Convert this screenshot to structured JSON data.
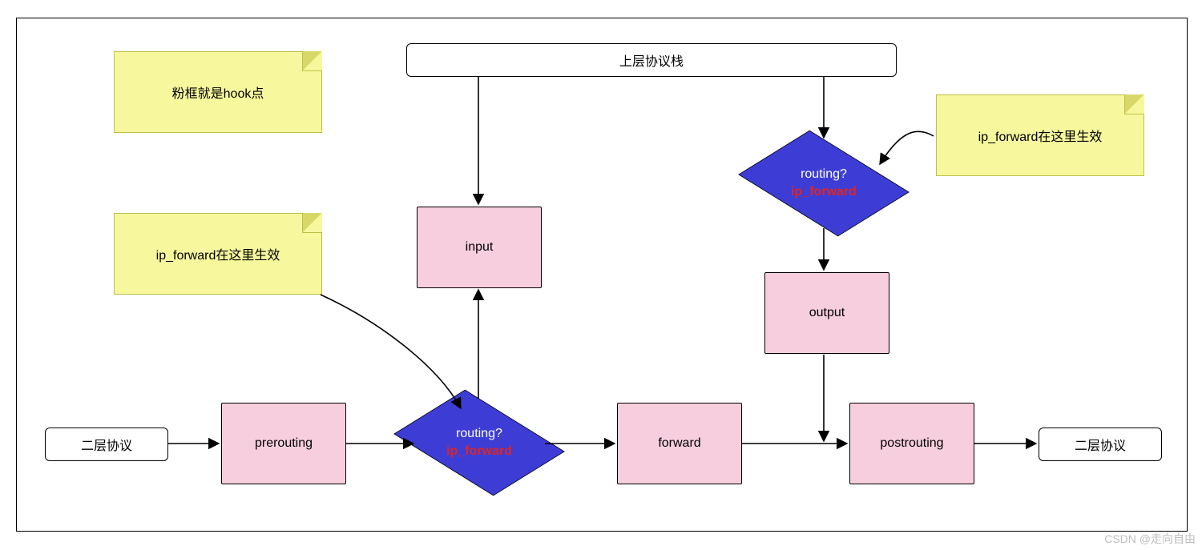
{
  "notes": {
    "legend": "粉框就是hook点",
    "ipf_upper": "ip_forward在这里生效",
    "ipf_lower": "ip_forward在这里生效"
  },
  "nodes": {
    "upper_stack": "上层协议栈",
    "l2_left": "二层协议",
    "l2_right": "二层协议",
    "prerouting": "prerouting",
    "input": "input",
    "forward": "forward",
    "output": "output",
    "postrouting": "postrouting"
  },
  "routing": {
    "question": "routing?",
    "flag": "ip_forward"
  },
  "watermark": "CSDN @走向自由"
}
